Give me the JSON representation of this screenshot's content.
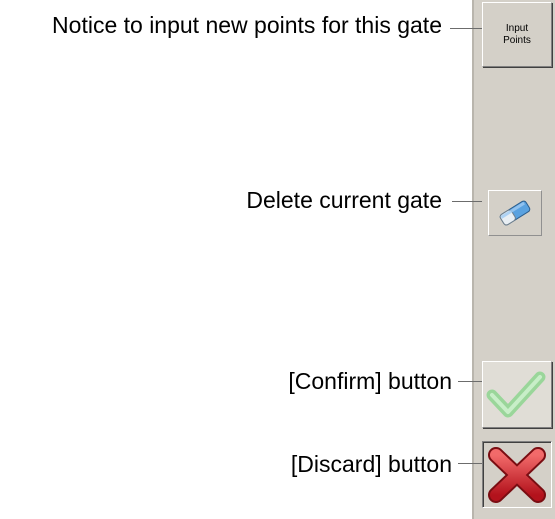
{
  "callouts": {
    "input_points": "Notice to input new points for this gate",
    "delete_gate": "Delete current gate",
    "confirm": "[Confirm] button",
    "discard": "[Discard] button"
  },
  "toolbar": {
    "input_points_label": "Input Points"
  },
  "icons": {
    "delete": "eraser-icon",
    "confirm": "checkmark-icon",
    "discard": "x-mark-icon"
  },
  "colors": {
    "toolbar_bg": "#d4d0c8",
    "checkmark": "#8ccf8c",
    "xmark": "#d4202a"
  }
}
